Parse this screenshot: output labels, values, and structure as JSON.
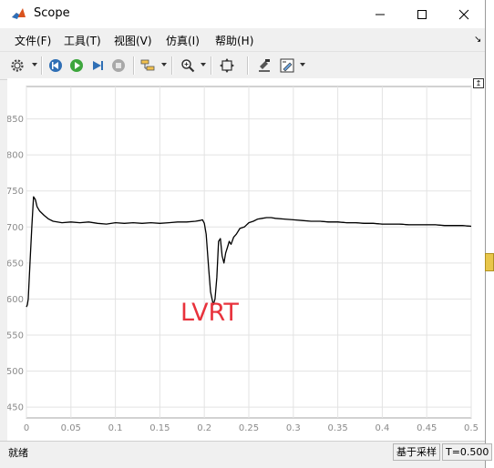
{
  "window": {
    "title": "Scope"
  },
  "menu": [
    {
      "label": "文件(F)"
    },
    {
      "label": "工具(T)"
    },
    {
      "label": "视图(V)"
    },
    {
      "label": "仿真(I)"
    },
    {
      "label": "帮助(H)"
    }
  ],
  "toolbar": {
    "icons": [
      "gear-icon",
      "step-back-icon",
      "run-icon",
      "step-forward-icon",
      "stop-icon",
      "signal-select-icon",
      "zoom-icon",
      "autoscale-icon",
      "highlight-icon",
      "style-icon"
    ]
  },
  "chart_data": {
    "type": "line",
    "title": "",
    "xlabel": "",
    "ylabel": "",
    "xlim": [
      0,
      0.5
    ],
    "ylim": [
      435,
      895
    ],
    "x_ticks": [
      "0",
      "0.05",
      "0.1",
      "0.15",
      "0.2",
      "0.25",
      "0.3",
      "0.35",
      "0.4",
      "0.45",
      "0.5"
    ],
    "y_ticks": [
      "450",
      "500",
      "550",
      "600",
      "650",
      "700",
      "750",
      "800",
      "850"
    ],
    "grid": true,
    "annotation": {
      "text": "LVRT",
      "color": "#e8323c"
    },
    "series": [
      {
        "color": "#000000",
        "x": [
          0.0,
          0.001,
          0.002,
          0.004,
          0.006,
          0.008,
          0.01,
          0.012,
          0.015,
          0.02,
          0.025,
          0.03,
          0.04,
          0.05,
          0.06,
          0.07,
          0.08,
          0.09,
          0.1,
          0.11,
          0.12,
          0.13,
          0.14,
          0.15,
          0.16,
          0.17,
          0.18,
          0.19,
          0.195,
          0.198,
          0.2,
          0.202,
          0.205,
          0.207,
          0.21,
          0.212,
          0.214,
          0.216,
          0.218,
          0.22,
          0.222,
          0.224,
          0.226,
          0.228,
          0.23,
          0.233,
          0.236,
          0.24,
          0.245,
          0.25,
          0.255,
          0.26,
          0.265,
          0.27,
          0.275,
          0.28,
          0.29,
          0.3,
          0.31,
          0.32,
          0.33,
          0.34,
          0.35,
          0.36,
          0.37,
          0.38,
          0.39,
          0.4,
          0.41,
          0.42,
          0.43,
          0.44,
          0.45,
          0.46,
          0.47,
          0.48,
          0.49,
          0.5
        ],
        "values": [
          589,
          592,
          600,
          650,
          700,
          742,
          738,
          728,
          722,
          716,
          711,
          708,
          706,
          707,
          706,
          707,
          705,
          704,
          706,
          705,
          706,
          705,
          706,
          705,
          706,
          707,
          707,
          708,
          709,
          710,
          705,
          690,
          640,
          610,
          592,
          600,
          630,
          680,
          684,
          660,
          650,
          664,
          672,
          680,
          676,
          686,
          690,
          698,
          700,
          706,
          708,
          711,
          712,
          713,
          713,
          712,
          711,
          710,
          709,
          708,
          708,
          707,
          707,
          706,
          706,
          705,
          705,
          704,
          704,
          704,
          703,
          703,
          703,
          703,
          702,
          702,
          702,
          701
        ]
      }
    ]
  },
  "status": {
    "left": "就绪",
    "mode": "基于采样",
    "time": "T=0.500"
  }
}
